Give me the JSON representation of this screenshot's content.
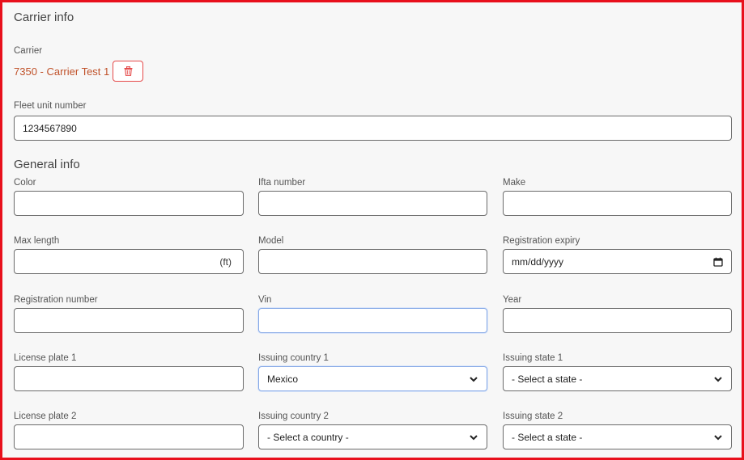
{
  "carrier_info": {
    "title": "Carrier info",
    "carrier_label": "Carrier",
    "carrier_value": "7350 - Carrier Test 1",
    "fleet_unit_label": "Fleet unit number",
    "fleet_unit_value": "1234567890"
  },
  "general_info": {
    "title": "General info",
    "color": {
      "label": "Color",
      "value": ""
    },
    "ifta_number": {
      "label": "Ifta number",
      "value": ""
    },
    "make": {
      "label": "Make",
      "value": ""
    },
    "max_length": {
      "label": "Max length",
      "value": "",
      "unit": "(ft)"
    },
    "model": {
      "label": "Model",
      "value": ""
    },
    "registration_expiry": {
      "label": "Registration expiry",
      "placeholder": "mm/dd/yyyy"
    },
    "registration_number": {
      "label": "Registration number",
      "value": ""
    },
    "vin": {
      "label": "Vin",
      "value": ""
    },
    "year": {
      "label": "Year",
      "value": ""
    },
    "license_plate_1": {
      "label": "License plate 1",
      "value": ""
    },
    "issuing_country_1": {
      "label": "Issuing country 1",
      "selected": "Mexico"
    },
    "issuing_state_1": {
      "label": "Issuing state 1",
      "selected": "- Select a state -"
    },
    "license_plate_2": {
      "label": "License plate 2",
      "value": ""
    },
    "issuing_country_2": {
      "label": "Issuing country 2",
      "selected": "- Select a country -"
    },
    "issuing_state_2": {
      "label": "Issuing state 2",
      "selected": "- Select a state -"
    }
  },
  "colors": {
    "frame_border": "#e8101c",
    "carrier_link": "#c0522a",
    "delete_button": "#e54a4a",
    "focus_border": "#86a9e6"
  },
  "icons": {
    "delete": "trash-icon",
    "dropdown": "chevron-down-icon",
    "date": "calendar-icon"
  }
}
